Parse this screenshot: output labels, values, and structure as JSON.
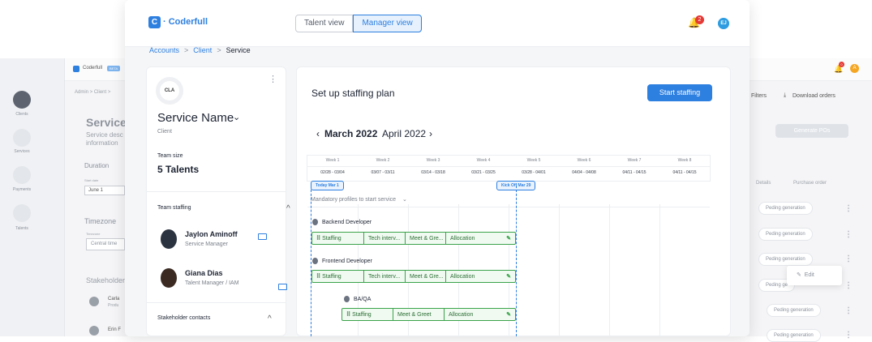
{
  "background_window": {
    "app_name": "Coderfull",
    "badge": "BETA",
    "breadcrumb": "Admin  >  Client  >",
    "nav": [
      {
        "label": "Clients"
      },
      {
        "label": "Services"
      },
      {
        "label": "Payments"
      },
      {
        "label": "Talents"
      }
    ],
    "section_title": "Service",
    "section_desc_1": "Service desc",
    "section_desc_2": "information",
    "duration_label": "Duration",
    "start_date_label": "Start date",
    "start_date_value": "June 1",
    "timezone_label": "Timezone",
    "timezone_field_label": "Timezone",
    "timezone_value": "Central time",
    "stakeholders_label": "Stakeholder",
    "stakeholder_1_name": "Carla",
    "stakeholder_1_sub": "Produ",
    "stakeholder_2_name": "Erin F",
    "filters_label": "Filters",
    "download_label": "Download orders",
    "generate_button": "Generate POs",
    "col_details": "Details",
    "col_po": "Purchase order",
    "pill_1": "Peding generation",
    "pill_2": "Peding generation",
    "pill_3": "Peding generation",
    "pill_4": "Peding ge",
    "pill_5": "Peding generation",
    "pill_6": "Peding generation",
    "edit_menu": "Edit",
    "notif_count": "0",
    "user_initial": "A"
  },
  "topbar": {
    "logo": "C",
    "app_name": "· Coderfull",
    "talent_view": "Talent view",
    "manager_view": "Manager view",
    "notif_count": "2",
    "avatar": "EJ"
  },
  "breadcrumb": {
    "a": "Accounts",
    "b": "Client",
    "c": "Service",
    "sep": ">"
  },
  "left_card": {
    "logo": "CLA",
    "service_name": "Service Name",
    "client_label": "Client",
    "team_size_label": "Team size",
    "team_size_value": "5 Talents",
    "team_staffing_label": "Team staffing",
    "members": [
      {
        "name": "Jaylon Aminoff",
        "role": "Service Manager"
      },
      {
        "name": "Giana Dias",
        "role": "Talent Manager / IAM"
      }
    ],
    "stakeholder_contacts_label": "Stakeholder contacts"
  },
  "plan": {
    "title": "Set up staffing plan",
    "start_button": "Start staffing",
    "month_current": "March 2022",
    "month_next": "April 2022",
    "weeks": [
      "Week 1",
      "Week 2",
      "Week 3",
      "Week 4",
      "Week 5",
      "Week 6",
      "Week 7",
      "Week 8"
    ],
    "ranges": [
      "02/28 - 03/04",
      "03/07 - 03/11",
      "03/14 - 03/18",
      "03/21 - 03/25",
      "03/28 - 04/01",
      "04/04 - 04/08",
      "04/11 - 04/15",
      "04/11 - 04/15"
    ],
    "today_marker": "Today Mar 1",
    "kickoff_marker": "Kick Off Mar 29",
    "mandatory_label": "Mandatory profiles to start service",
    "roles": [
      {
        "name": "Backend Developer",
        "stages": [
          "Staffing",
          "Tech interv...",
          "Meet & Gre...",
          "Allocation"
        ]
      },
      {
        "name": "Frontend Developer",
        "stages": [
          "Staffing",
          "Tech interv...",
          "Meet & Gre...",
          "Allocation"
        ]
      },
      {
        "name": "BA/QA",
        "stages": [
          "Staffing",
          "Meet & Greet",
          "Allocation"
        ]
      }
    ]
  },
  "colors": {
    "accent": "#2d7fe0",
    "green": "#3aa34a",
    "alert": "#e53935"
  }
}
